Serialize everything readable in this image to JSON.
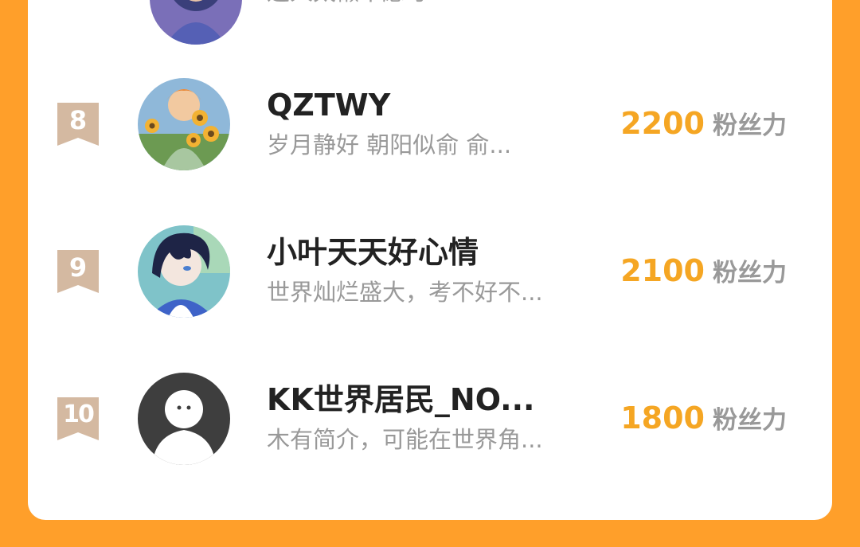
{
  "colors": {
    "background": "#FF9F2A",
    "card": "#FFFFFF",
    "fans_count": "#F5A623",
    "rank_badge": "#D4B9A1"
  },
  "partial_row": {
    "bio": "这人太懒不愿写"
  },
  "rows": [
    {
      "rank": "8",
      "name": "QZTWY",
      "bio": "岁月静好 朝阳似俞 俞...",
      "fans_count": "2200",
      "fans_label": "粉丝力",
      "avatar_icon": "anime-boy-with-sunflowers-avatar"
    },
    {
      "rank": "9",
      "name": "小叶天天好心情",
      "bio": "世界灿烂盛大，考不好不...",
      "fans_count": "2100",
      "fans_label": "粉丝力",
      "avatar_icon": "anime-dark-hair-boy-avatar"
    },
    {
      "rank": "10",
      "name": "KK世界居民_NO...",
      "bio": "木有简介，可能在世界角...",
      "fans_count": "1800",
      "fans_label": "粉丝力",
      "avatar_icon": "default-person-avatar"
    }
  ]
}
